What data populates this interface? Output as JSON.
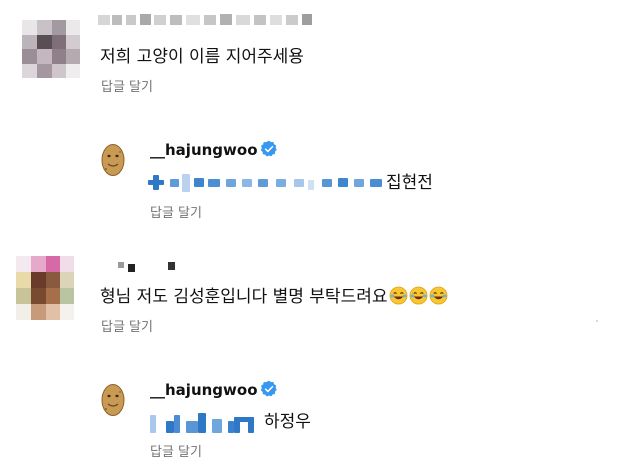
{
  "comments": [
    {
      "text": "저희 고양이 이름 지어주세용",
      "reply_action": "답글 달기",
      "reply": {
        "username": "__hajungwoo",
        "name_suffix": "집현전",
        "reply_action": "답글 달기"
      }
    },
    {
      "text": "형님 저도 김성훈입니다 별명 부탁드려요",
      "emoji": [
        "laughing-tears",
        "laughing-tears",
        "laughing-tears"
      ],
      "reply_action": "답글 달기",
      "reply": {
        "username": "__hajungwoo",
        "name_suffix": "하정우",
        "reply_action": "답글 달기"
      }
    }
  ],
  "colors": {
    "verified_badge": "#3897f0",
    "secondary_text": "#737373"
  },
  "icons": [
    "verified-badge-icon",
    "laughing-tears-emoji-icon",
    "potato-avatar-icon"
  ]
}
